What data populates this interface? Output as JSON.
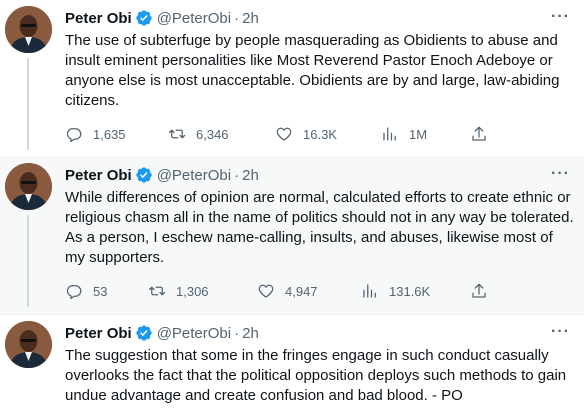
{
  "tweets": [
    {
      "name": "Peter Obi",
      "handle": "@PeterObi",
      "separator": "·",
      "time": "2h",
      "more": "···",
      "text": "The use of subterfuge by people masquerading as Obidients to abuse and insult eminent personalities like Most Reverend Pastor Enoch Adeboye or anyone else is most unacceptable. Obidients are by and large, law-abiding citizens.",
      "stats": {
        "replies": "1,635",
        "retweets": "6,346",
        "likes": "16.3K",
        "views": "1M"
      }
    },
    {
      "name": "Peter Obi",
      "handle": "@PeterObi",
      "separator": "·",
      "time": "2h",
      "more": "···",
      "text": "While differences of opinion are normal, calculated efforts to create ethnic or religious chasm all in the name of politics should not in any way be tolerated. As a person, I eschew name-calling, insults, and abuses, likewise most of my supporters.",
      "stats": {
        "replies": "53",
        "retweets": "1,306",
        "likes": "4,947",
        "views": "131.6K"
      }
    },
    {
      "name": "Peter Obi",
      "handle": "@PeterObi",
      "separator": "·",
      "time": "2h",
      "more": "···",
      "text": "The suggestion that some in the fringes engage in such conduct casually overlooks the fact that the political opposition deploys such methods to gain undue advantage and create confusion and bad blood. - PO"
    }
  ],
  "colors": {
    "verified": "#1d9bf0",
    "muted": "#536471",
    "text": "#0f1419",
    "thread_line": "#cfd9de"
  },
  "icons": [
    "verified-badge-icon",
    "reply-icon",
    "retweet-icon",
    "like-icon",
    "views-icon",
    "share-icon",
    "more-icon"
  ]
}
